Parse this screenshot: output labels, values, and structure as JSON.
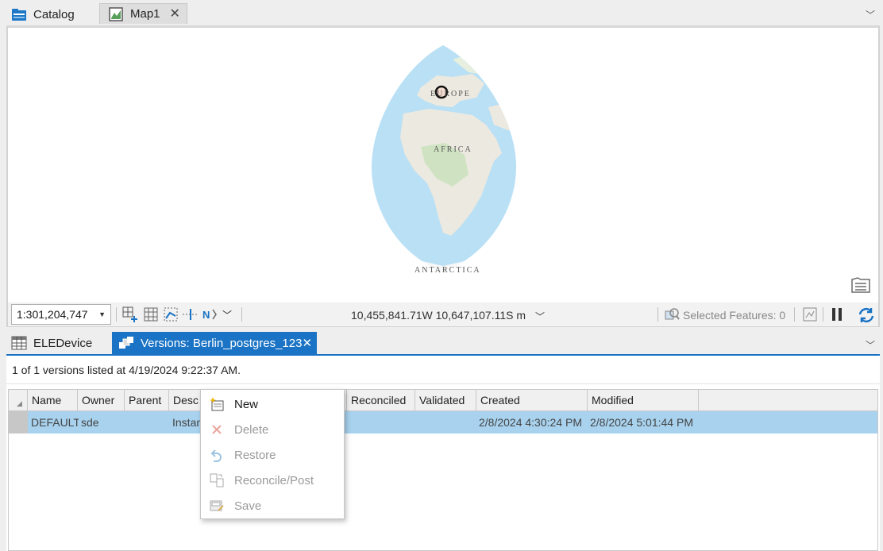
{
  "top_tabs": [
    {
      "label": "Catalog",
      "icon": "catalog-icon"
    },
    {
      "label": "Map1",
      "icon": "map-icon",
      "active": true
    }
  ],
  "map": {
    "labels": {
      "europe": "EUROPE",
      "africa": "AFRICA",
      "antarctica": "ANTARCTICA"
    },
    "status": {
      "scale": "1:301,204,747",
      "coordinates": "10,455,841.71W 10,647,107.11S m",
      "selected_features": "Selected Features: 0"
    }
  },
  "bottom_tabs": [
    {
      "label": "ELEDevice",
      "icon": "table-icon"
    },
    {
      "label": "Versions: Berlin_postgres_123",
      "icon": "versions-icon",
      "active": true
    }
  ],
  "versions": {
    "status_text": "1 of 1 versions listed at 4/19/2024 9:22:37 AM.",
    "columns": [
      "Name",
      "Owner",
      "Parent",
      "Desc",
      "Reconciled",
      "Validated",
      "Created",
      "Modified"
    ],
    "rows": [
      {
        "name": "DEFAULT",
        "owner": "sde",
        "parent": "",
        "description": "Instan",
        "reconciled": "",
        "validated": "",
        "created": "2/8/2024 4:30:24 PM",
        "modified": "2/8/2024 5:01:44 PM"
      }
    ]
  },
  "context_menu": {
    "items": [
      {
        "label": "New",
        "icon": "new-version-icon",
        "enabled": true
      },
      {
        "label": "Delete",
        "icon": "delete-icon",
        "enabled": false
      },
      {
        "label": "Restore",
        "icon": "restore-icon",
        "enabled": false
      },
      {
        "label": "Reconcile/Post",
        "icon": "reconcile-icon",
        "enabled": false
      },
      {
        "label": "Save",
        "icon": "save-icon",
        "enabled": false
      }
    ]
  },
  "colors": {
    "accent": "#1a73c4",
    "selected_row": "#a8d2ee",
    "ocean": "#b9e0f5",
    "land": "#ece9e0"
  }
}
